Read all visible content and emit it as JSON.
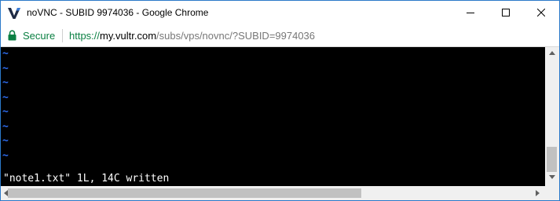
{
  "window": {
    "title": "noVNC - SUBID 9974036 - Google Chrome",
    "logo_icon": "vultr-v-logo-icon",
    "controls": [
      "minimize-icon",
      "maximize-icon",
      "close-icon"
    ]
  },
  "addressbar": {
    "secure_label": "Secure",
    "url_scheme": "https://",
    "url_host": "my.vultr.com",
    "url_path": "/subs/vps/novnc/?SUBID=9974036"
  },
  "terminal": {
    "empty_line_marker": "~",
    "status_line": "\"note1.txt\" 1L, 14C written"
  },
  "colors": {
    "tilde": "#2e6df0",
    "secure": "#0b8043",
    "terminal_bg": "#000000"
  }
}
